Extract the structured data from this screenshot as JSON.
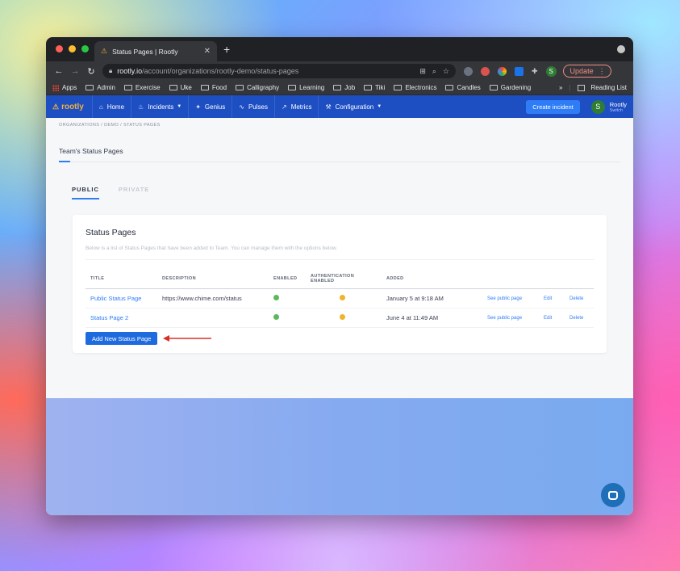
{
  "browser": {
    "tab_title": "Status Pages | Rootly",
    "url_host": "rootly.io",
    "url_path": "/account/organizations/rootly-demo/status-pages",
    "update_label": "Update",
    "profile_initial": "S",
    "bookmarks": [
      "Apps",
      "Admin",
      "Exercise",
      "Uke",
      "Food",
      "Calligraphy",
      "Learning",
      "Job",
      "Tiki",
      "Electronics",
      "Candles",
      "Gardening"
    ],
    "reading_list": "Reading List",
    "more_bookmarks": "»"
  },
  "app": {
    "logo": "rootly",
    "nav": [
      {
        "label": "Home",
        "icon": "home-icon"
      },
      {
        "label": "Incidents",
        "icon": "flame-icon",
        "dropdown": true
      },
      {
        "label": "Genius",
        "icon": "sparkle-icon"
      },
      {
        "label": "Pulses",
        "icon": "pulse-icon"
      },
      {
        "label": "Metrics",
        "icon": "chart-icon"
      },
      {
        "label": "Configuration",
        "icon": "wrench-icon",
        "dropdown": true
      }
    ],
    "create_incident": "Create incident",
    "user_initial": "S",
    "user_name": "Rootly",
    "user_sub": "Switch"
  },
  "page": {
    "breadcrumb": "ORGANIZATIONS  /  DEMO  /  STATUS PAGES",
    "title": "Team's Status Pages",
    "tabs": [
      "PUBLIC",
      "PRIVATE"
    ],
    "active_tab": "PUBLIC"
  },
  "card": {
    "title": "Status Pages",
    "description": "Below is a list of Status Pages that have been added to Team. You can manage them with the options below.",
    "columns": [
      "TITLE",
      "DESCRIPTION",
      "ENABLED",
      "AUTHENTICATION ENABLED",
      "ADDED",
      "",
      "",
      ""
    ],
    "rows": [
      {
        "title": "Public Status Page",
        "description": "https://www.chime.com/status",
        "enabled_color": "#5cb85c",
        "auth_color": "#f0b429",
        "added": "January 5 at 9:18 AM",
        "see": "See public page",
        "edit": "Edit",
        "delete": "Delete"
      },
      {
        "title": "Status Page 2",
        "description": "",
        "enabled_color": "#5cb85c",
        "auth_color": "#f0b429",
        "added": "June 4 at 11:49 AM",
        "see": "See public page",
        "edit": "Edit",
        "delete": "Delete"
      }
    ],
    "add_button": "Add New Status Page"
  },
  "colors": {
    "nav_bg": "#1d4ec2",
    "accent": "#2f7df6",
    "annotation_arrow": "#d93025"
  }
}
